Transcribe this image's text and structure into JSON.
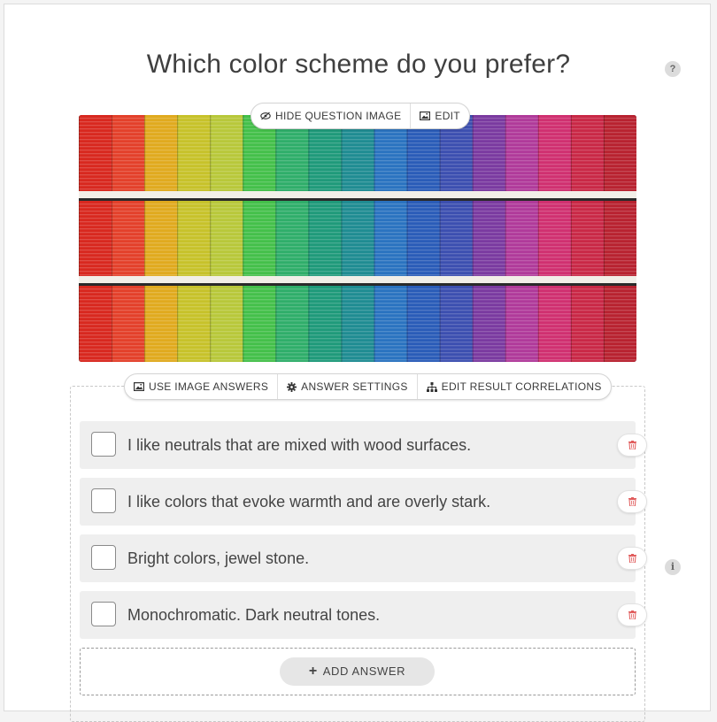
{
  "question": {
    "title": "Which color scheme do you prefer?",
    "help_icon_glyph": "?",
    "info_icon_glyph": "i"
  },
  "image_toolbar": {
    "hide_label": "HIDE QUESTION IMAGE",
    "edit_label": "EDIT"
  },
  "answers_toolbar": {
    "use_image_label": "USE IMAGE ANSWERS",
    "settings_label": "ANSWER SETTINGS",
    "correlations_label": "EDIT RESULT CORRELATIONS"
  },
  "answers": [
    {
      "text": "I like neutrals that are mixed with wood surfaces."
    },
    {
      "text": "I like colors that evoke warmth and are overly stark."
    },
    {
      "text": "Bright colors, jewel stone."
    },
    {
      "text": "Monochromatic. Dark neutral tones."
    }
  ],
  "add_answer": {
    "plus": "+",
    "label": "ADD ANSWER"
  },
  "colors": {
    "delete_icon": "#e05a5a",
    "card_bg": "#ffffff",
    "answer_bg": "#efefef"
  }
}
